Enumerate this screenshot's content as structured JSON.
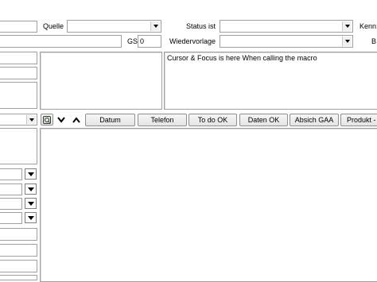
{
  "header": {
    "quelle_label": "Quelle",
    "status_label": "Status ist",
    "kenn_label": "Kenn:",
    "gs_label": "GS",
    "gs_value": "0",
    "wiedervorlage_label": "Wiedervorlage",
    "b_label": "B"
  },
  "memo": {
    "text": "Cursor & Focus is here When calling the macro"
  },
  "toolbar": {
    "buttons": [
      "Datum",
      "Telefon",
      "To do OK",
      "Daten OK",
      "Absich GAA",
      "Produkt -"
    ]
  },
  "icons": {
    "filter": "filter-icon",
    "sort_down": "chevron-down-icon",
    "sort_up": "chevron-up-icon",
    "combo_arrow": "dropdown-arrow-icon"
  }
}
